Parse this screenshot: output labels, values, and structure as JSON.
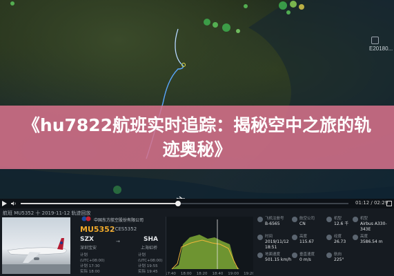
{
  "banner": {
    "title": "《hu7822航班实时追踪：揭秘空中之旅的轨迹奥秘》"
  },
  "map": {
    "marker_label": "E20180..."
  },
  "player": {
    "time": "01:12 / 02:29",
    "progress": 0.48
  },
  "panel": {
    "header": "航班 MU5352 十 2019-11-12 轨迹回放",
    "airline": "中国东方航空股份有限公司",
    "flight_no": "MU5352",
    "flight_code": "/ CES5352",
    "origin_code": "SZX",
    "origin_city": "深圳宝安",
    "dest_code": "SHA",
    "dest_city": "上海虹桥",
    "origin_lines": [
      "计划",
      "(UTC+08:00)",
      "计划 17:30",
      "实际 18:00"
    ],
    "dest_lines": [
      "计划",
      "(UTC+08:00)",
      "计划 19:55",
      "实际 19:45"
    ]
  },
  "chart_data": {
    "type": "area",
    "x_ticks": [
      "17:40",
      "18:00",
      "18:20",
      "18:40",
      "19:00",
      "19:20"
    ],
    "series": []
  },
  "stats": [
    {
      "label": "飞机注册号",
      "value": "B-6565"
    },
    {
      "label": "航空公司",
      "value": "CN"
    },
    {
      "label": "机型",
      "value": "12.6 千"
    },
    {
      "label": "机型",
      "value": "Airbus A330-343E"
    },
    {
      "label": "时间",
      "value": "2019/11/12 18:51"
    },
    {
      "label": "高度",
      "value": "115.67"
    },
    {
      "label": "经度",
      "value": "26.73"
    },
    {
      "label": "高度",
      "value": "3586.54 m"
    },
    {
      "label": "地面速度",
      "value": "501.15 km/h"
    },
    {
      "label": "垂直速度",
      "value": "0 m/s"
    },
    {
      "label": "航向",
      "value": "225°"
    },
    {
      "label": "",
      "value": ""
    }
  ]
}
